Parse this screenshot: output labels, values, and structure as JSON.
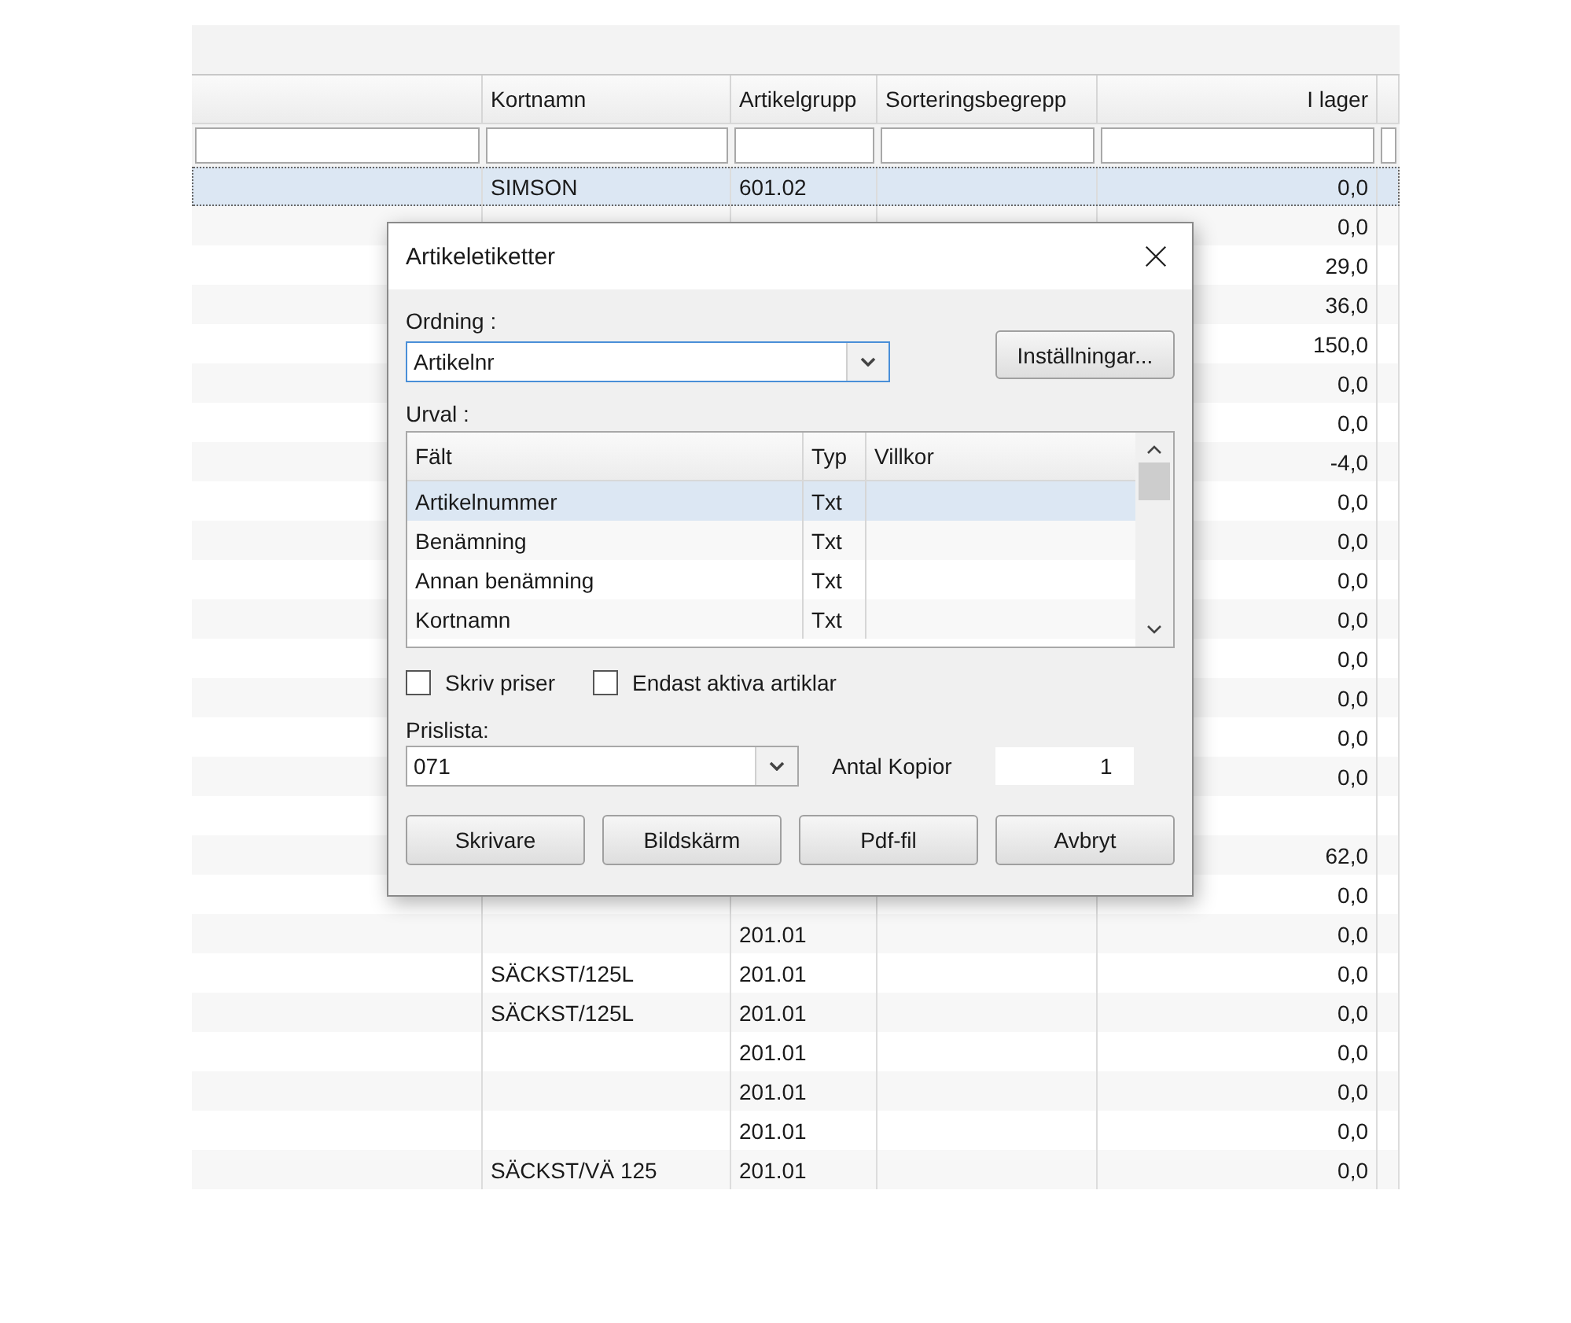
{
  "grid": {
    "columns": [
      "Kortnamn",
      "Artikelgrupp",
      "Sorteringsbegrepp",
      "I lager"
    ],
    "rows": [
      {
        "selected": true,
        "kortnamn": "SIMSON",
        "artikelgrupp": "601.02",
        "i_lager": "0,0"
      },
      {
        "selected": false,
        "i_lager": "0,0"
      },
      {
        "selected": false,
        "i_lager": "29,0"
      },
      {
        "selected": false,
        "i_lager": "36,0"
      },
      {
        "selected": false,
        "i_lager": "150,0"
      },
      {
        "selected": false,
        "i_lager": "0,0"
      },
      {
        "selected": false,
        "i_lager": "0,0"
      },
      {
        "selected": false,
        "i_lager": "-4,0"
      },
      {
        "selected": false,
        "i_lager": "0,0"
      },
      {
        "selected": false,
        "i_lager": "0,0"
      },
      {
        "selected": false,
        "i_lager": "0,0"
      },
      {
        "selected": false,
        "i_lager": "0,0"
      },
      {
        "selected": false,
        "i_lager": "0,0"
      },
      {
        "selected": false,
        "i_lager": "0,0"
      },
      {
        "selected": false,
        "i_lager": "0,0"
      },
      {
        "selected": false,
        "i_lager": "0,0"
      },
      {
        "selected": false
      },
      {
        "selected": false,
        "i_lager": "62,0"
      },
      {
        "selected": false,
        "i_lager": "0,0"
      },
      {
        "selected": false,
        "artikelgrupp": "201.01",
        "i_lager": "0,0"
      },
      {
        "selected": false,
        "kortnamn": "SÄCKST/125L",
        "artikelgrupp": "201.01",
        "i_lager": "0,0"
      },
      {
        "selected": false,
        "kortnamn": "SÄCKST/125L",
        "artikelgrupp": "201.01",
        "i_lager": "0,0"
      },
      {
        "selected": false,
        "artikelgrupp": "201.01",
        "i_lager": "0,0"
      },
      {
        "selected": false,
        "artikelgrupp": "201.01",
        "i_lager": "0,0"
      },
      {
        "selected": false,
        "artikelgrupp": "201.01",
        "i_lager": "0,0"
      },
      {
        "selected": false,
        "kortnamn": "SÄCKST/VÄ 125",
        "artikelgrupp": "201.01",
        "i_lager": "0,0"
      }
    ]
  },
  "dialog": {
    "title": "Artikeletiketter",
    "ordning": {
      "label": "Ordning :",
      "value": "Artikelnr"
    },
    "settings_button": "Inställningar...",
    "urval": {
      "label": "Urval :",
      "columns": [
        "Fält",
        "Typ",
        "Villkor"
      ],
      "rows": [
        {
          "falt": "Artikelnummer",
          "typ": "Txt",
          "selected": true
        },
        {
          "falt": "Benämning",
          "typ": "Txt",
          "selected": false
        },
        {
          "falt": "Annan benämning",
          "typ": "Txt",
          "selected": false
        },
        {
          "falt": "Kortnamn",
          "typ": "Txt",
          "selected": false
        }
      ]
    },
    "checkboxes": [
      {
        "label": "Skriv priser",
        "checked": false
      },
      {
        "label": "Endast aktiva artiklar",
        "checked": false
      }
    ],
    "prislista": {
      "label": "Prislista:",
      "value": "071"
    },
    "antal_kopior": {
      "label": "Antal Kopior",
      "value": "1"
    },
    "buttons": [
      "Skrivare",
      "Bildskärm",
      "Pdf-fil",
      "Avbryt"
    ]
  }
}
